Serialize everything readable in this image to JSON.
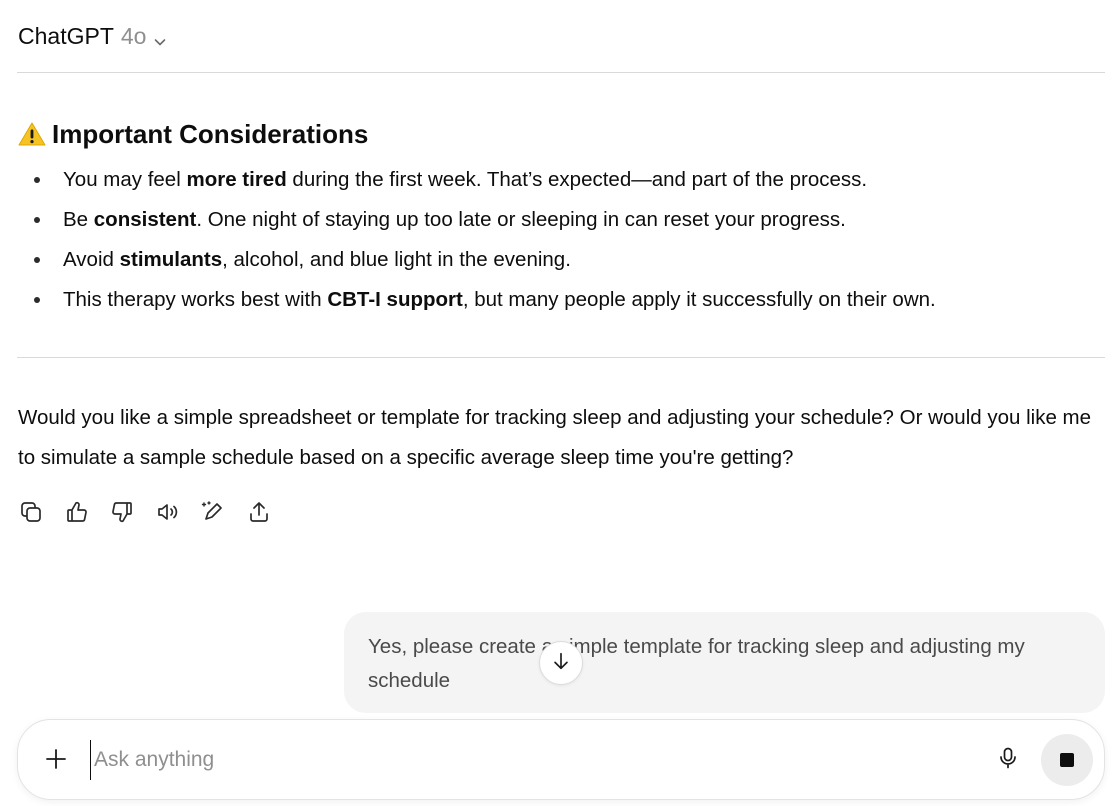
{
  "header": {
    "model_name": "ChatGPT",
    "model_version": "4o"
  },
  "response": {
    "section_emoji": "warning-icon",
    "section_title": "Important Considerations",
    "bullets": [
      {
        "pre": "You may feel ",
        "bold": "more tired",
        "post": " during the first week. That’s expected—and part of the process."
      },
      {
        "pre": "Be ",
        "bold": "consistent",
        "post": ". One night of staying up too late or sleeping in can reset your progress."
      },
      {
        "pre": "Avoid ",
        "bold": "stimulants",
        "post": ", alcohol, and blue light in the evening."
      },
      {
        "pre": "This therapy works best with ",
        "bold": "CBT-I support",
        "post": ", but many people apply it successfully on their own."
      }
    ],
    "question": "Would you like a simple spreadsheet or template for tracking sleep and adjusting your schedule? Or would you like me to simulate a sample schedule based on a specific average sleep time you're getting?",
    "actions": [
      "copy-icon",
      "thumbs-up-icon",
      "thumbs-down-icon",
      "read-aloud-icon",
      "edit-icon",
      "share-icon"
    ]
  },
  "user_message": {
    "text": "Yes, please create a simple template for tracking sleep and adjusting my schedule"
  },
  "composer": {
    "placeholder": "Ask anything",
    "value": ""
  },
  "colors": {
    "divider": "#d9d9d9",
    "bubble_bg": "#f4f4f4",
    "stop_bg": "#ececec",
    "muted_text": "#8f8f8f"
  }
}
